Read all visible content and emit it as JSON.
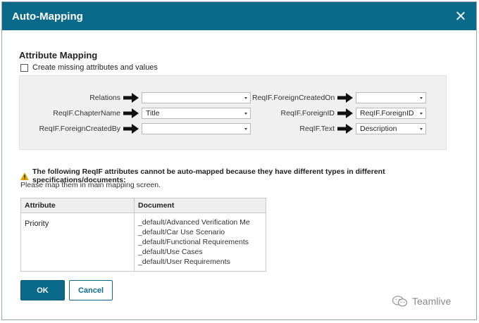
{
  "dialog": {
    "title": "Auto-Mapping",
    "close_icon": "close-icon"
  },
  "section": {
    "title": "Attribute Mapping",
    "create_missing_label": "Create missing attributes and values",
    "create_missing_checked": false
  },
  "mappings": {
    "left": [
      {
        "label": "Relations",
        "value": ""
      },
      {
        "label": "ReqIF.ChapterName",
        "value": "Title"
      },
      {
        "label": "ReqIF.ForeignCreatedBy",
        "value": ""
      }
    ],
    "right": [
      {
        "label": "ReqIF.ForeignCreatedOn",
        "value": ""
      },
      {
        "label": "ReqIF.ForeignID",
        "value": "ReqIF.ForeignID"
      },
      {
        "label": "ReqIF.Text",
        "value": "Description"
      }
    ]
  },
  "warning": {
    "icon": "warning-icon",
    "message": "The following ReqIF attributes cannot be auto-mapped because they have different types in different specifications/documents:",
    "sub": "Please map them in main mapping screen."
  },
  "table": {
    "headers": [
      "Attribute",
      "Document"
    ],
    "rows": [
      {
        "attribute": "Priority",
        "documents": [
          "_default/Advanced Verification Me",
          "_default/Car Use Scenario",
          "_default/Functional Requirements",
          "_default/Use Cases",
          "_default/User Requirements"
        ]
      }
    ]
  },
  "buttons": {
    "ok": "OK",
    "cancel": "Cancel"
  },
  "watermark": {
    "text": "Teamlive",
    "icon": "wechat-icon"
  },
  "colors": {
    "accent": "#0b6a8a",
    "panel": "#f0f0f0",
    "warning": "#e0a800"
  }
}
